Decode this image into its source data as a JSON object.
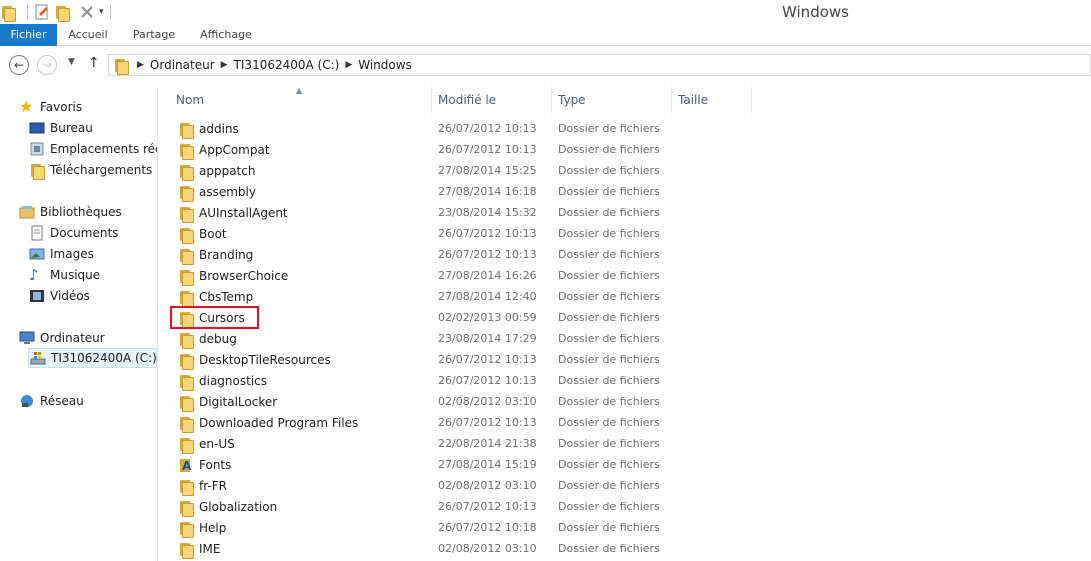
{
  "window": {
    "title": "Windows"
  },
  "ribbon": {
    "tabs": [
      "Fichier",
      "Accueil",
      "Partage",
      "Affichage"
    ]
  },
  "address": {
    "crumbs": [
      "Ordinateur",
      "TI31062400A (C:)",
      "Windows"
    ]
  },
  "nav": {
    "favorites": {
      "label": "Favoris",
      "items": [
        "Bureau",
        "Emplacements récents",
        "Téléchargements"
      ]
    },
    "libraries": {
      "label": "Bibliothèques",
      "items": [
        "Documents",
        "Images",
        "Musique",
        "Vidéos"
      ]
    },
    "computer": {
      "label": "Ordinateur",
      "items": [
        "TI31062400A (C:)"
      ]
    },
    "network": {
      "label": "Réseau"
    }
  },
  "columns": {
    "name": "Nom",
    "modified": "Modifié le",
    "type": "Type",
    "size": "Taille"
  },
  "files": [
    {
      "name": "addins",
      "date": "26/07/2012 10:13",
      "type": "Dossier de fichiers"
    },
    {
      "name": "AppCompat",
      "date": "26/07/2012 10:13",
      "type": "Dossier de fichiers"
    },
    {
      "name": "apppatch",
      "date": "27/08/2014 15:25",
      "type": "Dossier de fichiers"
    },
    {
      "name": "assembly",
      "date": "27/08/2014 16:18",
      "type": "Dossier de fichiers"
    },
    {
      "name": "AUInstallAgent",
      "date": "23/08/2014 15:32",
      "type": "Dossier de fichiers"
    },
    {
      "name": "Boot",
      "date": "26/07/2012 10:13",
      "type": "Dossier de fichiers"
    },
    {
      "name": "Branding",
      "date": "26/07/2012 10:13",
      "type": "Dossier de fichiers"
    },
    {
      "name": "BrowserChoice",
      "date": "27/08/2014 16:26",
      "type": "Dossier de fichiers"
    },
    {
      "name": "CbsTemp",
      "date": "27/08/2014 12:40",
      "type": "Dossier de fichiers"
    },
    {
      "name": "Cursors",
      "date": "02/02/2013 00:59",
      "type": "Dossier de fichiers"
    },
    {
      "name": "debug",
      "date": "23/08/2014 17:29",
      "type": "Dossier de fichiers"
    },
    {
      "name": "DesktopTileResources",
      "date": "26/07/2012 10:13",
      "type": "Dossier de fichiers"
    },
    {
      "name": "diagnostics",
      "date": "26/07/2012 10:13",
      "type": "Dossier de fichiers"
    },
    {
      "name": "DigitalLocker",
      "date": "02/08/2012 03:10",
      "type": "Dossier de fichiers"
    },
    {
      "name": "Downloaded Program Files",
      "date": "26/07/2012 10:13",
      "type": "Dossier de fichiers"
    },
    {
      "name": "en-US",
      "date": "22/08/2014 21:38",
      "type": "Dossier de fichiers"
    },
    {
      "name": "Fonts",
      "date": "27/08/2014 15:19",
      "type": "Dossier de fichiers"
    },
    {
      "name": "fr-FR",
      "date": "02/08/2012 03:10",
      "type": "Dossier de fichiers"
    },
    {
      "name": "Globalization",
      "date": "26/07/2012 10:13",
      "type": "Dossier de fichiers"
    },
    {
      "name": "Help",
      "date": "26/07/2012 10:18",
      "type": "Dossier de fichiers"
    },
    {
      "name": "IME",
      "date": "02/08/2012 03:10",
      "type": "Dossier de fichiers"
    }
  ],
  "colors": {
    "accent": "#1979ca",
    "highlight": "#e81123",
    "header_text": "#4c607a"
  }
}
